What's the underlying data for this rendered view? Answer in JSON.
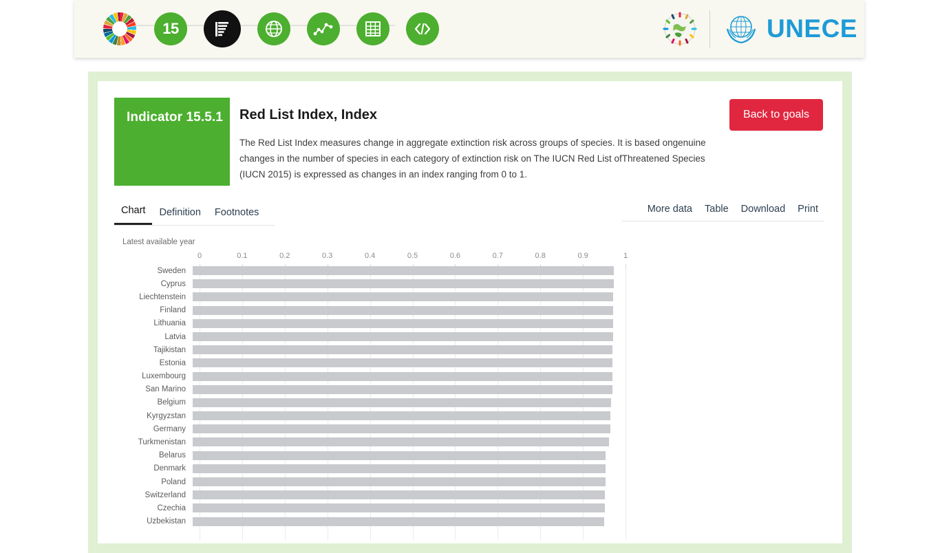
{
  "topbar": {
    "icons": [
      {
        "name": "sdg-wheel-icon",
        "label": "SDG colour wheel",
        "type": "wheel"
      },
      {
        "name": "goal-15-icon",
        "label": "15",
        "type": "green-number"
      },
      {
        "name": "chart-bars-icon",
        "label": "bar chart",
        "type": "black"
      },
      {
        "name": "globe-icon",
        "label": "globe",
        "type": "green"
      },
      {
        "name": "trend-line-icon",
        "label": "trend line",
        "type": "green"
      },
      {
        "name": "table-grid-icon",
        "label": "table",
        "type": "green"
      },
      {
        "name": "code-icon",
        "label": "</>",
        "type": "green"
      }
    ],
    "org_name": "UNECE",
    "brand_color": "#1d9bd7",
    "green_color": "#4caf2f"
  },
  "indicator": {
    "badge_label": "Indicator 15.5.1",
    "title": "Red List Index, Index",
    "description": "The Red List Index measures change in aggregate extinction risk across groups of species. It is based ongenuine changes in the number of species in each category of extinction risk on The IUCN Red List ofThreatened Species (IUCN 2015) is expressed as changes in an index ranging from 0 to 1.",
    "back_button": "Back to goals",
    "badge_color": "#4caf2f",
    "button_color": "#e0273f"
  },
  "tabs": [
    {
      "label": "Chart",
      "active": true
    },
    {
      "label": "Definition",
      "active": false
    },
    {
      "label": "Footnotes",
      "active": false
    }
  ],
  "actions": [
    {
      "label": "More data"
    },
    {
      "label": "Table"
    },
    {
      "label": "Download"
    },
    {
      "label": "Print"
    }
  ],
  "chart_data": {
    "type": "bar",
    "orientation": "horizontal",
    "title": "",
    "caption": "Latest available year",
    "xlabel": "",
    "ylabel": "",
    "xlim": [
      0,
      1
    ],
    "xticks": [
      "0",
      "0.1",
      "0.2",
      "0.3",
      "0.4",
      "0.5",
      "0.6",
      "0.7",
      "0.8",
      "0.9",
      "1"
    ],
    "grid": true,
    "legend": "none",
    "bar_color": "#c9cace",
    "categories": [
      "Sweden",
      "Cyprus",
      "Liechtenstein",
      "Finland",
      "Lithuania",
      "Latvia",
      "Tajikistan",
      "Estonia",
      "Luxembourg",
      "San Marino",
      "Belgium",
      "Kyrgyzstan",
      "Germany",
      "Turkmenistan",
      "Belarus",
      "Denmark",
      "Poland",
      "Switzerland",
      "Czechia",
      "Uzbekistan"
    ],
    "values": [
      0.988,
      0.988,
      0.987,
      0.987,
      0.987,
      0.987,
      0.986,
      0.986,
      0.986,
      0.986,
      0.982,
      0.981,
      0.98,
      0.978,
      0.97,
      0.97,
      0.969,
      0.968,
      0.967,
      0.966
    ]
  }
}
